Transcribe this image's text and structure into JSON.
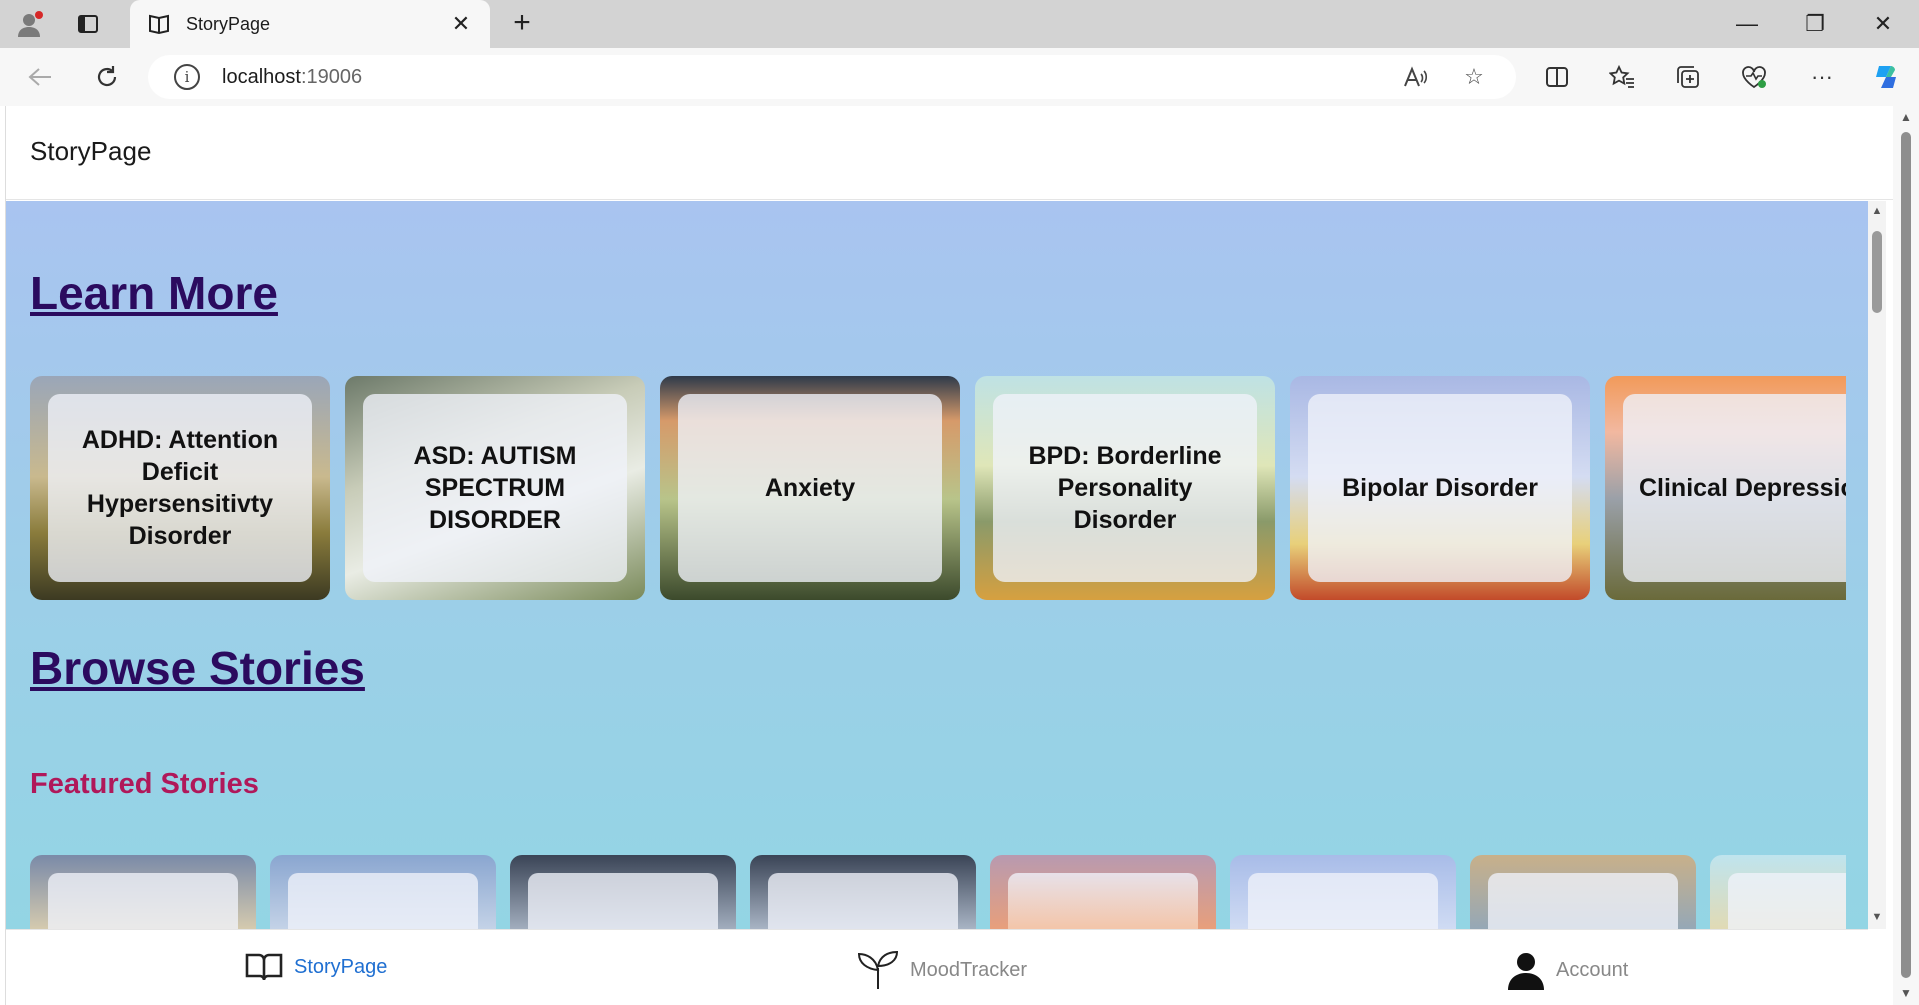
{
  "browser": {
    "tab_title": "StoryPage",
    "close_tab": "✕",
    "new_tab": "+",
    "url_host": "localhost",
    "url_port": ":19006",
    "win_minimize": "—",
    "win_restore": "❐",
    "win_close": "✕"
  },
  "app": {
    "header_title": "StoryPage"
  },
  "sections": {
    "learn_more": "Learn More",
    "browse_stories": "Browse Stories",
    "featured_stories": "Featured Stories"
  },
  "learn_cards": [
    {
      "label": "ADHD: Attention Deficit Hypersensitivty Disorder"
    },
    {
      "label": "ASD: AUTISM SPECTRUM DISORDER"
    },
    {
      "label": "Anxiety"
    },
    {
      "label": "BPD: Borderline Personality Disorder"
    },
    {
      "label": "Bipolar Disorder"
    },
    {
      "label": "Clinical Depression"
    }
  ],
  "bottom_nav": [
    {
      "label": "StoryPage",
      "icon": "open-book-icon",
      "active": true
    },
    {
      "label": "MoodTracker",
      "icon": "sprout-icon",
      "active": false
    },
    {
      "label": "Account",
      "icon": "person-icon",
      "active": false
    }
  ],
  "colors": {
    "heading": "#2b0b5f",
    "featured": "#b0185a",
    "active_nav": "#1f6fd1",
    "inactive_nav": "#888888"
  }
}
